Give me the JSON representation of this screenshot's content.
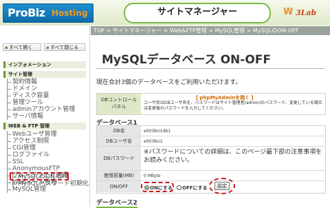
{
  "header": {
    "logo_main": "ProBiz",
    "logo_sub": "Hosting",
    "title": "サイトマネージャー",
    "brand_glyph": "W",
    "brand_text": "3Lab"
  },
  "breadcrumb": "TOP > サイトマネージャー > Web&FTP管理 > MySQL管理 > MySQLのON-OFF",
  "sidebar": {
    "open_all": "すべて開く",
    "close_all": "すべて閉じる",
    "sections": [
      "インフォメーション",
      "サイト管理",
      "WEB & FTP 管理"
    ],
    "site_items": [
      "契約情報",
      "ドメイン",
      "ディスク容量",
      "管理ツール",
      "adminアカウント管理",
      "サーバ情報"
    ],
    "web_items": [
      "Webユーザ管理",
      "アクセス制限",
      "CGI管理",
      "ログファイル",
      "SSL",
      "AnonymousFTP",
      "グループウェア管理",
      "Webメール管理",
      "MySQL管理",
      "MySQLのON-OFF",
      "MySQLパスワード初期化"
    ]
  },
  "main": {
    "title": "MySQLデータベース ON-OFF",
    "summary": "現在合計3個のデータベースをご利用いただけます。",
    "pma": {
      "label_line1": "DBコントロール",
      "label_line2": "パネル",
      "link": "【 phpMyAdminを開く 】",
      "desc": "ユーザ名はDBユーザ名を、パスワードはサイト管理者(admin)のパスワード、変更している場合は変更後のパスワードを入力してください。"
    },
    "db1": {
      "heading": "データベース1",
      "rows": [
        {
          "key": "DB名",
          "value": "e0039ci1db1"
        },
        {
          "key": "DBユーザ名",
          "value": "e0039ci1"
        },
        {
          "key": "DBパスワード",
          "value": "※パスワードについての詳細は、このページ最下部の注意事項をお読みください。"
        },
        {
          "key": "使用容量(MB)",
          "value": "0 MByte"
        },
        {
          "key": "ON/OFF",
          "value": ""
        }
      ],
      "on_label": "ONにする",
      "off_label": "OFFにする",
      "set_button": "設定"
    },
    "db2_heading": "データベース2"
  }
}
